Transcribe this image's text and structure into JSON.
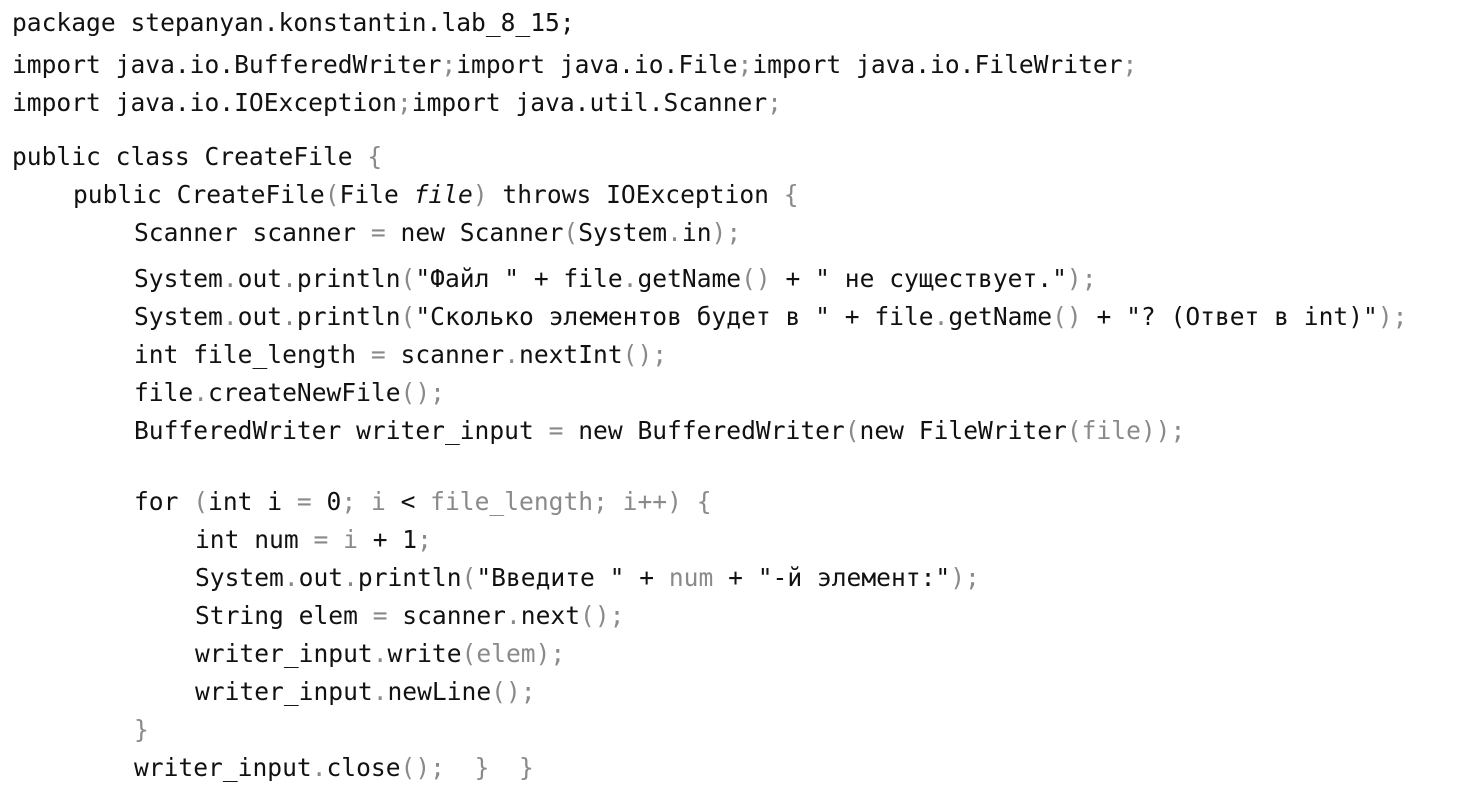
{
  "code": {
    "lines": [
      {
        "indent": 0,
        "segments": [
          {
            "t": "package stepanyan.konstantin.lab_8_15;"
          }
        ]
      },
      {
        "indent": 0,
        "segments": [
          {
            "t": "import java.io.BufferedWriter"
          },
          {
            "t": ";",
            "c": "d"
          },
          {
            "t": "import java.io.File"
          },
          {
            "t": ";",
            "c": "d"
          },
          {
            "t": "import java.io.FileWriter"
          },
          {
            "t": ";",
            "c": "d"
          }
        ]
      },
      {
        "indent": 0,
        "segments": [
          {
            "t": "import java.io.IOException"
          },
          {
            "t": ";",
            "c": "d"
          },
          {
            "t": "import java.util.Scanner"
          },
          {
            "t": ";",
            "c": "d"
          }
        ]
      },
      {
        "indent": 0,
        "segments": [
          {
            "t": "public class CreateFile "
          },
          {
            "t": "{",
            "c": "d"
          }
        ]
      },
      {
        "indent": 1,
        "segments": [
          {
            "t": "public CreateFile"
          },
          {
            "t": "(",
            "c": "d"
          },
          {
            "t": "File "
          },
          {
            "t": "file",
            "c": "it"
          },
          {
            "t": ")",
            "c": "d"
          },
          {
            "t": " throws IOException "
          },
          {
            "t": "{",
            "c": "d"
          }
        ]
      },
      {
        "indent": 2,
        "segments": [
          {
            "t": "Scanner scanner "
          },
          {
            "t": "=",
            "c": "d"
          },
          {
            "t": " new Scanner"
          },
          {
            "t": "(",
            "c": "d"
          },
          {
            "t": "System"
          },
          {
            "t": ".",
            "c": "d"
          },
          {
            "t": "in"
          },
          {
            "t": ");",
            "c": "d"
          }
        ]
      },
      {
        "indent": 2,
        "segments": [
          {
            "t": "System"
          },
          {
            "t": ".",
            "c": "d"
          },
          {
            "t": "out"
          },
          {
            "t": ".",
            "c": "d"
          },
          {
            "t": "println"
          },
          {
            "t": "(",
            "c": "d"
          },
          {
            "t": "\"Файл \" + file"
          },
          {
            "t": ".",
            "c": "d"
          },
          {
            "t": "getName"
          },
          {
            "t": "()",
            "c": "d"
          },
          {
            "t": " + \" не существует.\""
          },
          {
            "t": ");",
            "c": "d"
          }
        ]
      },
      {
        "indent": 2,
        "segments": [
          {
            "t": "System"
          },
          {
            "t": ".",
            "c": "d"
          },
          {
            "t": "out"
          },
          {
            "t": ".",
            "c": "d"
          },
          {
            "t": "println"
          },
          {
            "t": "(",
            "c": "d"
          },
          {
            "t": "\"Сколько элементов будет в \" + file"
          },
          {
            "t": ".",
            "c": "d"
          },
          {
            "t": "getName"
          },
          {
            "t": "()",
            "c": "d"
          },
          {
            "t": " + \"? (Ответ в int)\""
          },
          {
            "t": ");",
            "c": "d"
          }
        ]
      },
      {
        "indent": 2,
        "segments": [
          {
            "t": "int file_length "
          },
          {
            "t": "=",
            "c": "d"
          },
          {
            "t": " scanner"
          },
          {
            "t": ".",
            "c": "d"
          },
          {
            "t": "nextInt"
          },
          {
            "t": "();",
            "c": "d"
          }
        ]
      },
      {
        "indent": 2,
        "segments": [
          {
            "t": "file"
          },
          {
            "t": ".",
            "c": "d"
          },
          {
            "t": "createNewFile"
          },
          {
            "t": "();",
            "c": "d"
          }
        ]
      },
      {
        "indent": 2,
        "segments": [
          {
            "t": "BufferedWriter writer_input "
          },
          {
            "t": "=",
            "c": "d"
          },
          {
            "t": " new BufferedWriter"
          },
          {
            "t": "(",
            "c": "d"
          },
          {
            "t": "new FileWriter"
          },
          {
            "t": "(file));",
            "c": "d"
          }
        ]
      },
      {
        "indent": 2,
        "segments": [
          {
            "t": "for "
          },
          {
            "t": "(",
            "c": "d"
          },
          {
            "t": "int i "
          },
          {
            "t": "=",
            "c": "d"
          },
          {
            "t": " 0"
          },
          {
            "t": "; i ",
            "c": "d"
          },
          {
            "t": "<"
          },
          {
            "t": " file_length; i++) {",
            "c": "d"
          }
        ]
      },
      {
        "indent": 3,
        "segments": [
          {
            "t": "int num "
          },
          {
            "t": "= i",
            "c": "d"
          },
          {
            "t": " + 1"
          },
          {
            "t": ";",
            "c": "d"
          }
        ]
      },
      {
        "indent": 3,
        "segments": [
          {
            "t": "System"
          },
          {
            "t": ".",
            "c": "d"
          },
          {
            "t": "out"
          },
          {
            "t": ".",
            "c": "d"
          },
          {
            "t": "println"
          },
          {
            "t": "(",
            "c": "d"
          },
          {
            "t": "\"Введите \" + "
          },
          {
            "t": "num",
            "c": "d"
          },
          {
            "t": " + \"-й элемент:\""
          },
          {
            "t": ");",
            "c": "d"
          }
        ]
      },
      {
        "indent": 3,
        "segments": [
          {
            "t": "String elem "
          },
          {
            "t": "=",
            "c": "d"
          },
          {
            "t": " scanner"
          },
          {
            "t": ".",
            "c": "d"
          },
          {
            "t": "next"
          },
          {
            "t": "();",
            "c": "d"
          }
        ]
      },
      {
        "indent": 3,
        "segments": [
          {
            "t": "writer_input"
          },
          {
            "t": ".",
            "c": "d"
          },
          {
            "t": "write"
          },
          {
            "t": "(elem);",
            "c": "d"
          }
        ]
      },
      {
        "indent": 3,
        "segments": [
          {
            "t": "writer_input"
          },
          {
            "t": ".",
            "c": "d"
          },
          {
            "t": "newLine"
          },
          {
            "t": "();",
            "c": "d"
          }
        ]
      },
      {
        "indent": 2,
        "segments": [
          {
            "t": "}",
            "c": "d"
          }
        ]
      },
      {
        "indent": 2,
        "segments": [
          {
            "t": "writer_input"
          },
          {
            "t": ".",
            "c": "d"
          },
          {
            "t": "close"
          },
          {
            "t": "();  }  }",
            "c": "d"
          }
        ]
      }
    ]
  }
}
